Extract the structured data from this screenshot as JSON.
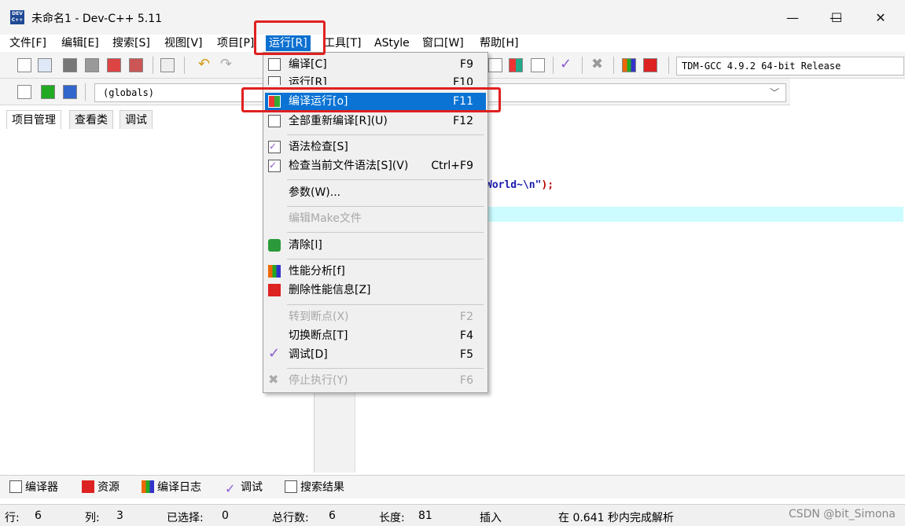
{
  "window": {
    "title": "未命名1 - Dev-C++ 5.11",
    "logo_text": "DEV C++",
    "minimize": "—",
    "maximize": "☐",
    "close": "✕"
  },
  "menubar": [
    {
      "label": "文件[F]"
    },
    {
      "label": "编辑[E]"
    },
    {
      "label": "搜索[S]"
    },
    {
      "label": "视图[V]"
    },
    {
      "label": "项目[P]"
    },
    {
      "label": "运行[R]"
    },
    {
      "label": "工具[T]"
    },
    {
      "label": "AStyle"
    },
    {
      "label": "窗口[W]"
    },
    {
      "label": "帮助[H]"
    }
  ],
  "compiler_select": {
    "value": "TDM-GCC 4.9.2 64-bit Release"
  },
  "scope_select": {
    "value": "(globals)",
    "arrow": "﹀"
  },
  "left_tabs": [
    "项目管理",
    "查看类",
    "调试"
  ],
  "editor": {
    "code_fragment": "World~\\n\"",
    "code_tail": ");"
  },
  "run_menu": {
    "items": [
      {
        "label": "编译[C]",
        "shortcut": "F9",
        "icon": "compile-icon"
      },
      {
        "label": "运行[R]",
        "shortcut": "F10",
        "icon": "run-icon"
      },
      {
        "label": "编译运行[o]",
        "shortcut": "F11",
        "icon": "compile-run-icon",
        "highlighted": true
      },
      {
        "label": "全部重新编译[R](U)",
        "shortcut": "F12",
        "icon": "rebuild-all-icon"
      },
      {
        "label": "语法检查[S]",
        "shortcut": "",
        "icon": "syntax-check-icon"
      },
      {
        "label": "检查当前文件语法[S](V)",
        "shortcut": "Ctrl+F9",
        "icon": "syntax-check-file-icon"
      },
      {
        "label": "参数(W)...",
        "shortcut": "",
        "icon": ""
      },
      {
        "label": "编辑Make文件",
        "shortcut": "",
        "icon": "",
        "disabled": true
      },
      {
        "label": "清除[l]",
        "shortcut": "",
        "icon": "clean-icon"
      },
      {
        "label": "性能分析[f]",
        "shortcut": "",
        "icon": "profile-icon"
      },
      {
        "label": "删除性能信息[Z]",
        "shortcut": "",
        "icon": "delete-profile-icon"
      },
      {
        "label": "转到断点(X)",
        "shortcut": "F2",
        "icon": "",
        "disabled": true
      },
      {
        "label": "切换断点[T]",
        "shortcut": "F4",
        "icon": ""
      },
      {
        "label": "调试[D]",
        "shortcut": "F5",
        "icon": "debug-check-icon"
      },
      {
        "label": "停止执行(Y)",
        "shortcut": "F6",
        "icon": "stop-icon",
        "disabled": true
      }
    ]
  },
  "bottom_tabs": [
    "编译器",
    "资源",
    "编译日志",
    "调试",
    "搜索结果"
  ],
  "status": {
    "row_label": "行:",
    "row": "6",
    "col_label": "列:",
    "col": "3",
    "sel_label": "已选择:",
    "sel": "0",
    "lines_label": "总行数:",
    "lines": "6",
    "len_label": "长度:",
    "len": "81",
    "mode": "插入",
    "parse_msg": "在 0.641 秒内完成解析"
  },
  "watermark": "CSDN @bit_Simona",
  "colors": {
    "highlight": "#0a73d4",
    "annotation_box": "#e02020",
    "current_line": "#ccfcff"
  }
}
